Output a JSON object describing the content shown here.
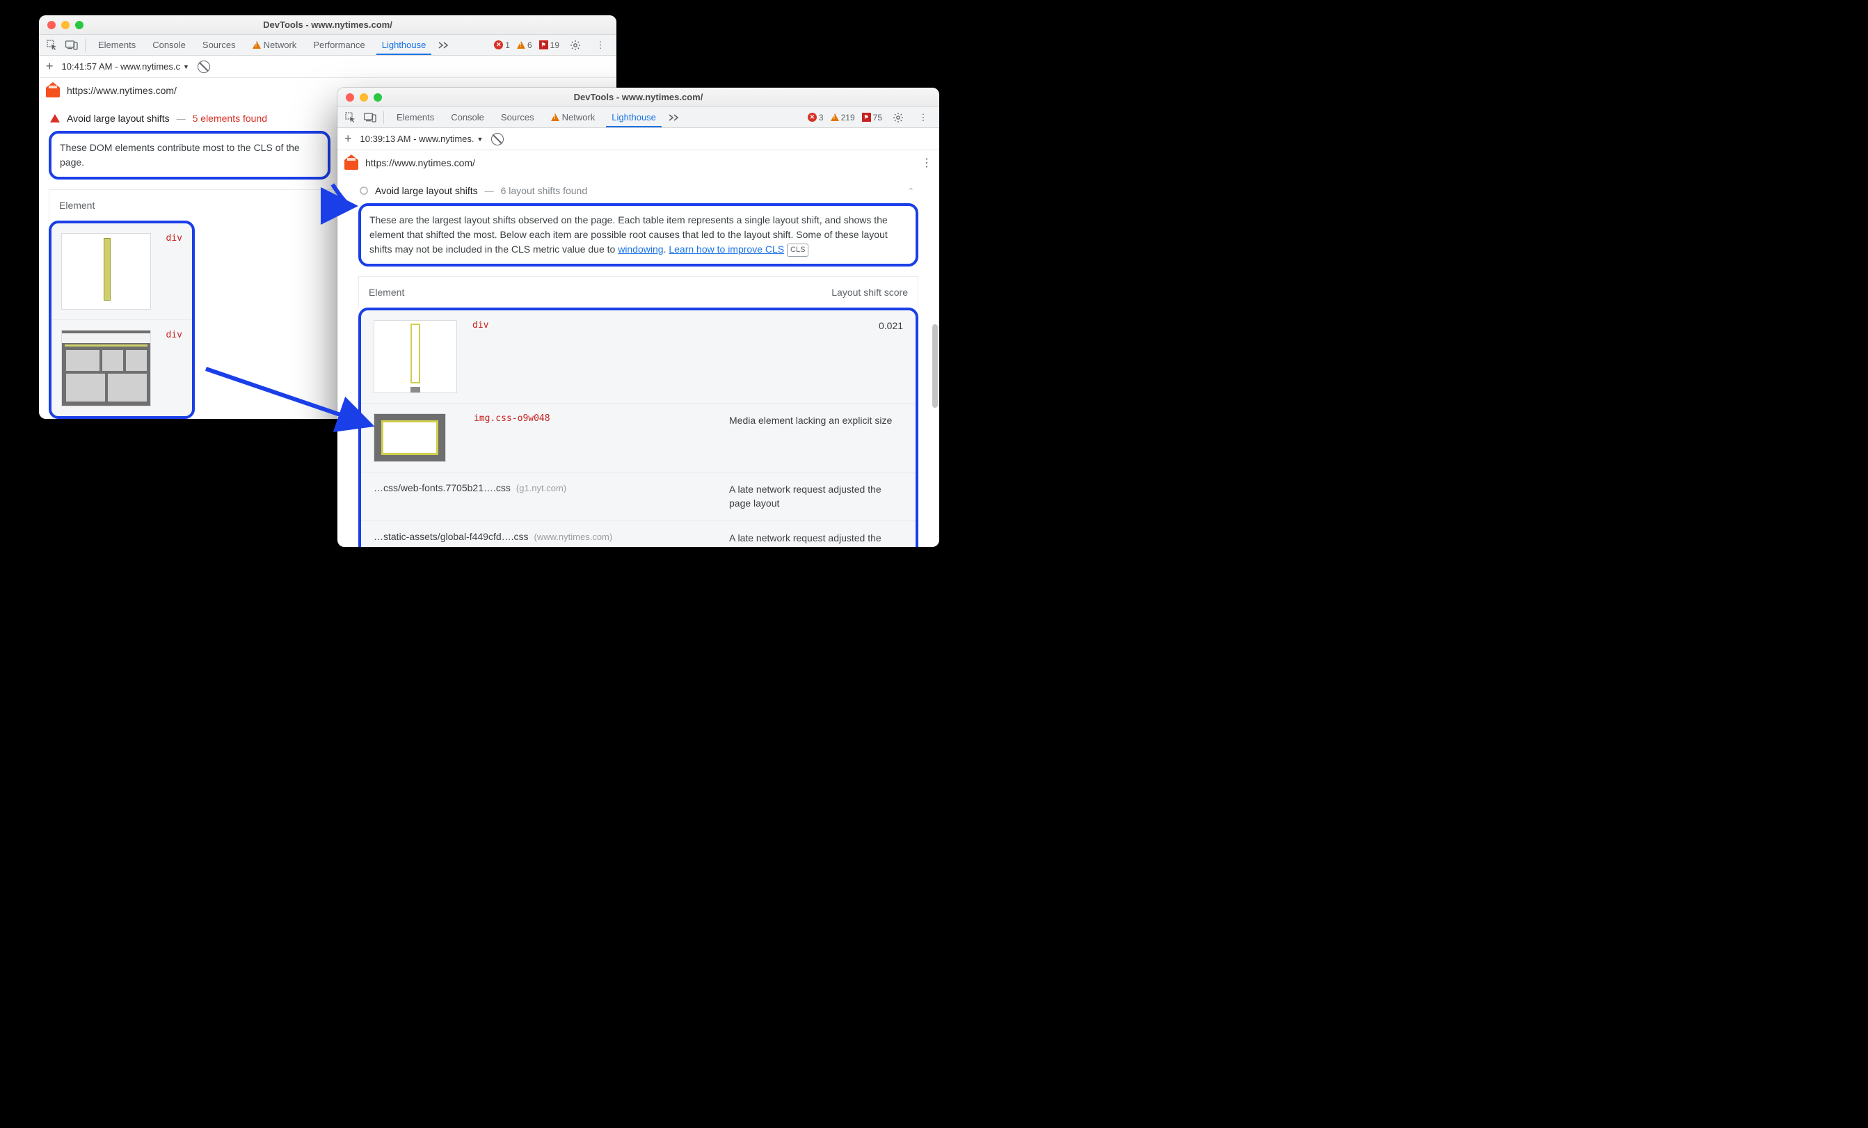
{
  "left": {
    "title": "DevTools - www.nytimes.com/",
    "tabs": [
      "Elements",
      "Console",
      "Sources",
      "Network",
      "Performance",
      "Lighthouse"
    ],
    "activeTab": "Lighthouse",
    "networkWarn": true,
    "errCount": "1",
    "warnCount": "6",
    "issueCount": "19",
    "run": "10:41:57 AM - www.nytimes.c",
    "url": "https://www.nytimes.com/",
    "audit": {
      "title": "Avoid large layout shifts",
      "summary": "5 elements found",
      "desc": "These DOM elements contribute most to the CLS of the page.",
      "colElement": "Element",
      "rows": [
        {
          "code": "div"
        },
        {
          "code": "div"
        }
      ]
    }
  },
  "right": {
    "title": "DevTools - www.nytimes.com/",
    "tabs": [
      "Elements",
      "Console",
      "Sources",
      "Network",
      "Lighthouse"
    ],
    "activeTab": "Lighthouse",
    "networkWarn": true,
    "errCount": "3",
    "warnCount": "219",
    "issueCount": "75",
    "run": "10:39:13 AM - www.nytimes.",
    "url": "https://www.nytimes.com/",
    "audit": {
      "title": "Avoid large layout shifts",
      "summary": "6 layout shifts found",
      "descPre": "These are the largest layout shifts observed on the page. Each table item represents a single layout shift, and shows the element that shifted the most. Below each item are possible root causes that led to the layout shift. Some of these layout shifts may not be included in the CLS metric value due to ",
      "linkWindowing": "windowing",
      "linkLearn": "Learn how to improve CLS",
      "badge": "CLS",
      "colElement": "Element",
      "colScore": "Layout shift score",
      "rows": {
        "r0": {
          "code": "div",
          "score": "0.021"
        },
        "r1": {
          "code": "img.css-o9w048",
          "desc": "Media element lacking an explicit size"
        },
        "r2": {
          "file": "…css/web-fonts.7705b21….css",
          "host": "(g1.nyt.com)",
          "desc": "A late network request adjusted the page layout"
        },
        "r3": {
          "file": "…static-assets/global-f449cfd….css",
          "host": "(www.nytimes.com)",
          "desc": "A late network request adjusted the page layout"
        }
      }
    }
  }
}
